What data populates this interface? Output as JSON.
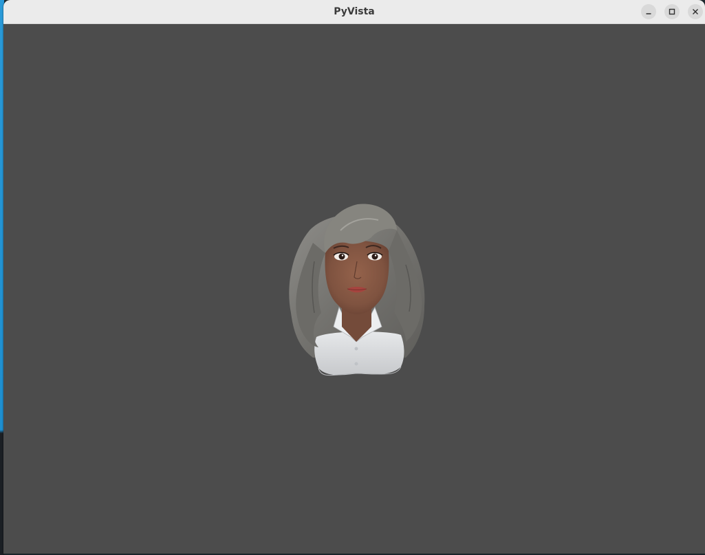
{
  "window": {
    "title": "PyVista",
    "controls": {
      "minimize_icon": "minimize-icon",
      "maximize_icon": "maximize-icon",
      "close_icon": "close-icon"
    }
  },
  "viewport": {
    "background_color": "#4c4c4c",
    "model": "avatar-head-bust"
  },
  "colors": {
    "titlebar": "#ebebeb",
    "hair": "#7a7a76",
    "skin": "#8a5a45",
    "shirt": "#d8dadc"
  }
}
